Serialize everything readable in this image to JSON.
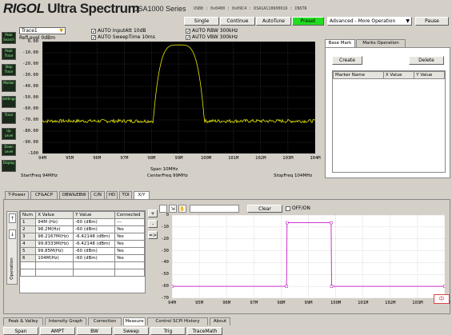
{
  "app": {
    "brand": "RIGOL",
    "product": "Ultra Spectrum",
    "series": "DSA1000 Series",
    "usb_info": "USB0 : 0x0400 : 0x09C4 : DSA1A110600019 : INSTR"
  },
  "toolbar": {
    "single": "Single",
    "continue": "Continue",
    "autotune": "AutoTune",
    "preset": "Preset",
    "mode": "Advanced - More Operation",
    "pause": "Pause"
  },
  "trace_select": "Trace1",
  "ref_level": "RefLevel  0dBm",
  "checks": {
    "input_att": "AUTO InputAtt  10dB",
    "sweep_time": "AUTO SweepTime  10ms",
    "rbw": "AUTO RBW  300kHz",
    "vbw": "AUTO VBW  300kHz"
  },
  "left_icons": [
    {
      "label": "Peak Search",
      "icon": "peak-search-icon"
    },
    {
      "label": "Peak Trace",
      "icon": "peak-trace-icon"
    },
    {
      "label": "Step Trace",
      "icon": "step-trace-icon"
    },
    {
      "label": "Marker",
      "icon": "marker-icon"
    },
    {
      "label": "Settings",
      "icon": "settings-icon"
    },
    {
      "label": "Trace",
      "icon": "trace-icon"
    },
    {
      "label": "Up Level",
      "icon": "up-level-icon"
    },
    {
      "label": "Down Level",
      "icon": "down-level-icon"
    },
    {
      "label": "Display",
      "icon": "display-icon"
    }
  ],
  "spectrum": {
    "y_labels": [
      "0.00",
      "-10.00",
      "-20.00",
      "-30.00",
      "-40.00",
      "-50.00",
      "-60.00",
      "-70.00",
      "-80.00",
      "-90.00",
      "-100"
    ],
    "x_labels": [
      "94M",
      "95M",
      "96M",
      "97M",
      "98M",
      "99M",
      "100M",
      "101M",
      "102M",
      "103M",
      "104M"
    ],
    "start_freq": "StartFreq  94MHz",
    "span": "Span  10MHz",
    "center_freq": "CenterFreq  99MHz",
    "stop_freq": "StopFreq  104MHz"
  },
  "marker_panel": {
    "tabs": [
      "Base Mark",
      "Marks Operation"
    ],
    "create": "Create",
    "delete": "Delete",
    "columns": [
      "Marker Name",
      "X Value",
      "Y Value"
    ]
  },
  "lower_tabs": [
    "T-Power",
    "CF&ACP",
    "OBW&EBW",
    "C/N",
    "HD",
    "TOI",
    "X/Y"
  ],
  "xy_table": {
    "columns": [
      "Num",
      "X Value",
      "Y Value",
      "Connected"
    ],
    "rows": [
      [
        "1",
        "94M (Hz)",
        "-60 (dBm)",
        "---"
      ],
      [
        "2",
        "98.2M(Hz)",
        "-60 (dBm)",
        "Yes"
      ],
      [
        "3",
        "98.2167M(Hz)",
        "-6.42148 (dBm)",
        "Yes"
      ],
      [
        "4",
        "99.8333M(Hz)",
        "-6.42148 (dBm)",
        "Yes"
      ],
      [
        "5",
        "99.85M(Hz)",
        "-60 (dBm)",
        "Yes"
      ],
      [
        "6",
        "104M(Hz)",
        "-60 (dBm)",
        "Yes"
      ]
    ],
    "side_label": "Operation",
    "plus": "+",
    "minus": "-",
    "arrow": "=>"
  },
  "xy_chart_toolbar": {
    "clear": "Clear",
    "offon": "OFF/ON"
  },
  "chart_data": {
    "type": "line",
    "x_tick_labels": [
      "94M",
      "95M",
      "96M",
      "97M",
      "98M",
      "99M",
      "100M",
      "101M",
      "102M",
      "103M",
      "104M"
    ],
    "y_tick_labels": [
      "0",
      "-10",
      "-20",
      "-30",
      "-40",
      "-50",
      "-60",
      "-70"
    ],
    "ylim": [
      -70,
      0
    ],
    "xlim_mhz": [
      94,
      104
    ],
    "series": [
      {
        "color": "#cc33cc",
        "x_mhz": [
          94,
          98.2,
          98.2167,
          99.8333,
          99.85,
          104
        ],
        "y_dbm": [
          -60,
          -60,
          -6.42148,
          -6.42148,
          -60,
          -60
        ]
      }
    ],
    "grid": true
  },
  "bottom_tabs": [
    "Peak & Valley",
    "Intensity Graph",
    "Correction",
    "Measure",
    "Control SCPI History",
    "About"
  ],
  "bottom_buttons": [
    "Span",
    "AMPT",
    "BW",
    "Sweep",
    "Trig",
    "TraceMath"
  ],
  "ime_badge": "中",
  "colors": {
    "preset_green": "#22dd22",
    "trace_yellow": "#e8e800",
    "mask_magenta": "#cc33cc",
    "grid_gray": "#444444"
  }
}
